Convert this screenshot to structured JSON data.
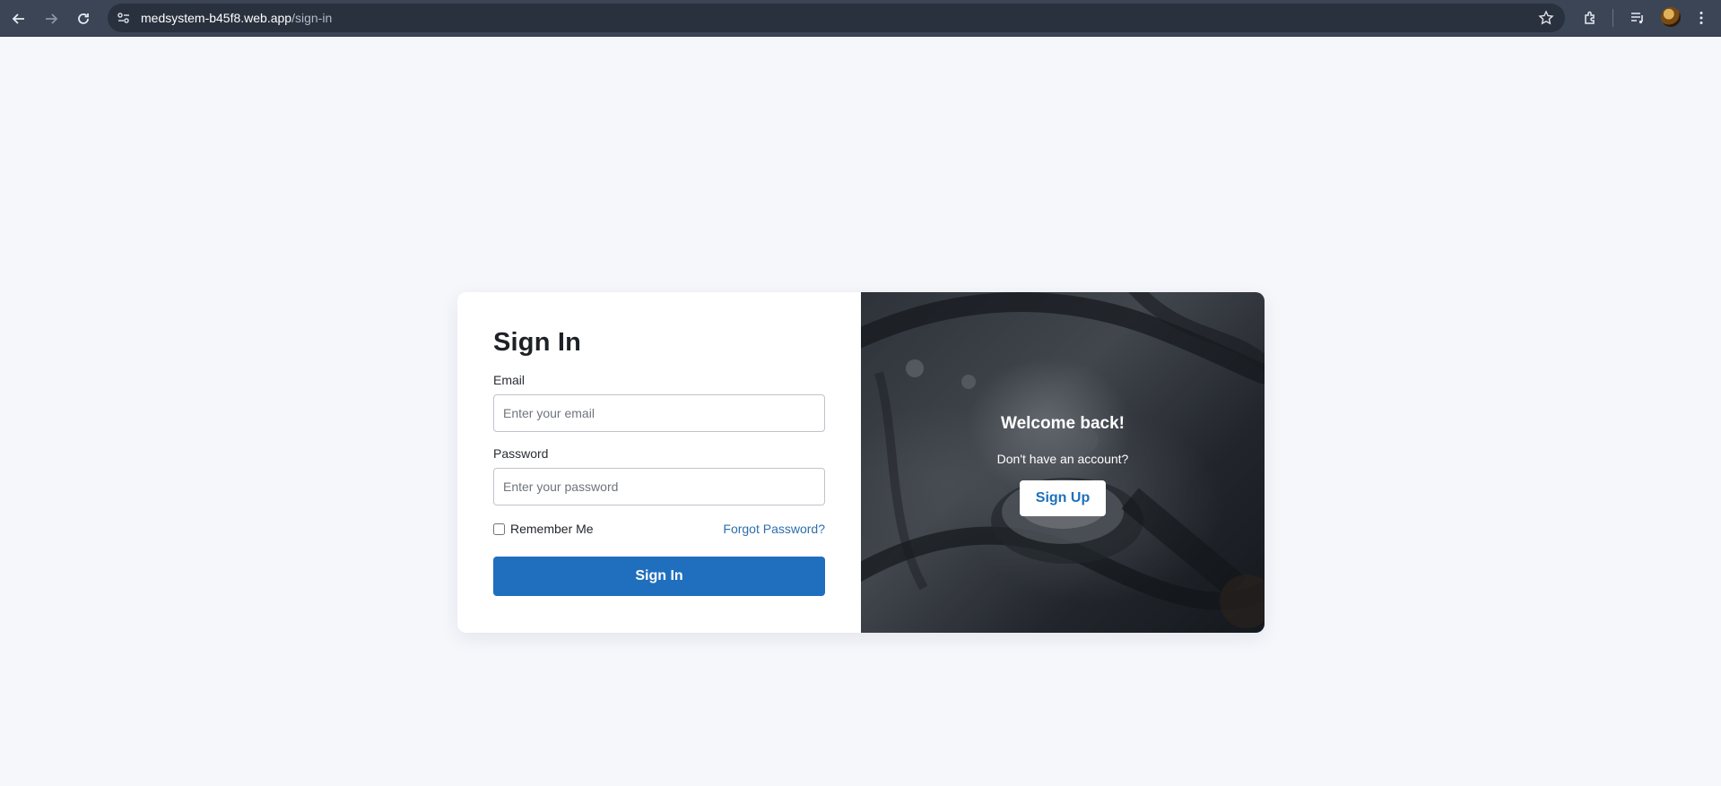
{
  "browser": {
    "url_host": "medsystem-b45f8.web.app",
    "url_path": "/sign-in"
  },
  "signin": {
    "title": "Sign In",
    "email_label": "Email",
    "email_placeholder": "Enter your email",
    "password_label": "Password",
    "password_placeholder": "Enter your password",
    "remember_label": "Remember Me",
    "remember_checked": false,
    "forgot_label": "Forgot Password?",
    "submit_label": "Sign In"
  },
  "promo": {
    "heading": "Welcome back!",
    "subtext": "Don't have an account?",
    "signup_label": "Sign Up"
  },
  "colors": {
    "primary": "#1f6fbe",
    "page_bg": "#f5f7fb",
    "chrome_bg": "#3c4556"
  }
}
